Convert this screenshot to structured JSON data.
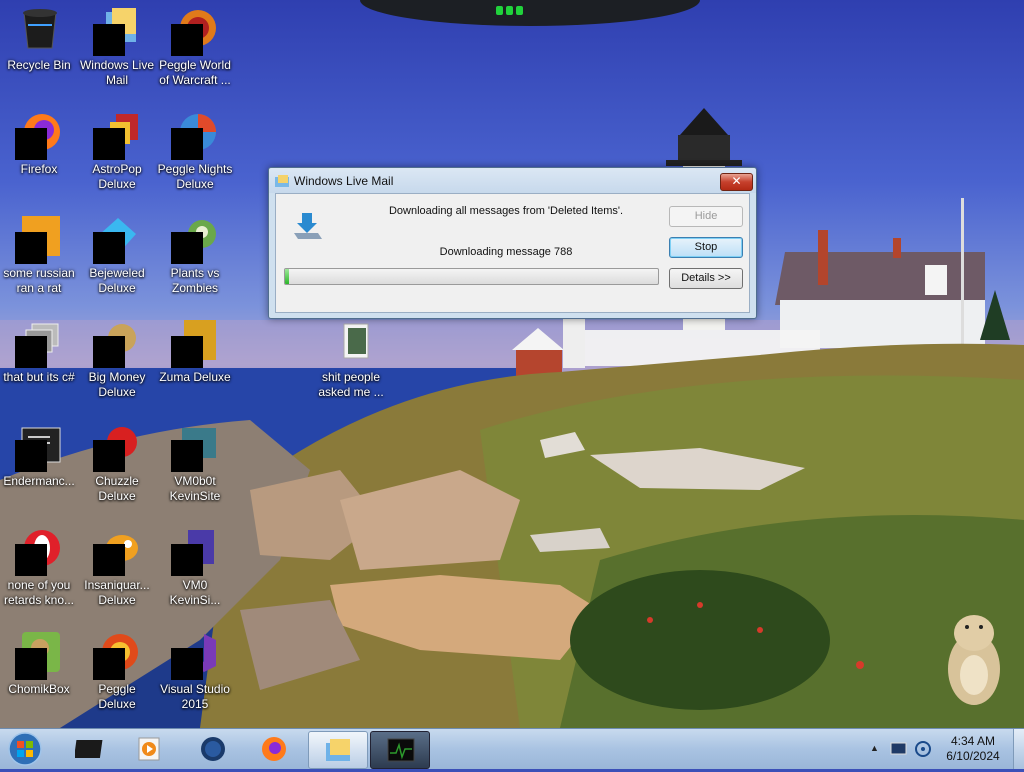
{
  "desktop": {
    "icons": [
      {
        "label": "Recycle Bin"
      },
      {
        "label": "Windows Live Mail"
      },
      {
        "label": "Peggle World of Warcraft ..."
      },
      {
        "label": "Firefox"
      },
      {
        "label": "AstroPop Deluxe"
      },
      {
        "label": "Peggle Nights Deluxe"
      },
      {
        "label": "some russian ran a rat"
      },
      {
        "label": "Bejeweled Deluxe"
      },
      {
        "label": "Plants vs Zombies"
      },
      {
        "label": "that but its c#"
      },
      {
        "label": "Big Money Deluxe"
      },
      {
        "label": "Zuma Deluxe"
      },
      {
        "label": "shit people asked me ..."
      },
      {
        "label": "Endermanc..."
      },
      {
        "label": "Chuzzle Deluxe"
      },
      {
        "label": "VM0b0t KevinSite"
      },
      {
        "label": "none of you retards kno..."
      },
      {
        "label": "Insaniquar... Deluxe"
      },
      {
        "label": "VM0 KevinSi..."
      },
      {
        "label": "ChomikBox"
      },
      {
        "label": "Peggle Deluxe"
      },
      {
        "label": "Visual Studio 2015"
      }
    ]
  },
  "dialog": {
    "title": "Windows Live Mail",
    "close_label": "✕",
    "message": "Downloading all messages from 'Deleted Items'.",
    "status": "Downloading message 788",
    "progress_fraction": 0.01,
    "buttons": {
      "hide": "Hide",
      "stop": "Stop",
      "details": "Details >>"
    }
  },
  "taskbar": {
    "clock_time": "4:34 AM",
    "clock_date": "6/10/2024",
    "tray_arrow": "▲"
  }
}
